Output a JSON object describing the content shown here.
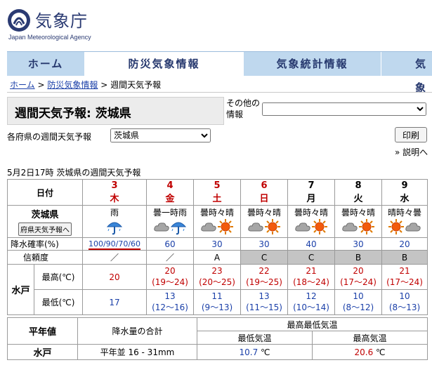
{
  "agency": {
    "name_jp": "気象庁",
    "name_en": "Japan Meteorological Agency"
  },
  "nav": {
    "tabs": [
      "ホーム",
      "防災気象情報",
      "気象統計情報",
      "気象"
    ],
    "active_index": 1
  },
  "breadcrumb": {
    "items": [
      "ホーム",
      "防災気象情報",
      "週間天気予報"
    ],
    "separator": ">"
  },
  "page": {
    "title": "週間天気予報: 茨城県",
    "other_info_label": "その他の情報",
    "other_info_value": "",
    "pref_label": "各府県の週間天気予報",
    "pref_select_value": "茨城県",
    "print_label": "印刷",
    "help_label": "» 説明へ",
    "issued": "5月2日17時  茨城県の週間天気予報"
  },
  "forecast": {
    "header_label": "日付",
    "region": "茨城県",
    "region_button": "府県天気予報へ",
    "precip_label": "降水確率(%)",
    "reliability_label": "信頼度",
    "city": "水戸",
    "max_label": "最高(℃)",
    "min_label": "最低(℃)",
    "days": [
      {
        "date": "3",
        "dow": "木",
        "kind": "hol",
        "weather": "雨",
        "icons": [
          "umbrella"
        ],
        "precip": "100/90/70/60",
        "reliability": "／",
        "rel_grey": false,
        "max": "20",
        "max_range": "",
        "min": "17",
        "min_range": ""
      },
      {
        "date": "4",
        "dow": "金",
        "kind": "hol",
        "weather": "曇一時雨",
        "icons": [
          "cloud",
          "umbrella"
        ],
        "precip": "60",
        "reliability": "／",
        "rel_grey": false,
        "max": "20",
        "max_range": "(19～24)",
        "min": "13",
        "min_range": "(12～16)"
      },
      {
        "date": "5",
        "dow": "土",
        "kind": "hol",
        "weather": "曇時々晴",
        "icons": [
          "cloud",
          "sun"
        ],
        "precip": "30",
        "reliability": "A",
        "rel_grey": false,
        "max": "23",
        "max_range": "(20～25)",
        "min": "11",
        "min_range": "(9～13)"
      },
      {
        "date": "6",
        "dow": "日",
        "kind": "sun",
        "weather": "曇時々晴",
        "icons": [
          "cloud",
          "sun"
        ],
        "precip": "30",
        "reliability": "C",
        "rel_grey": true,
        "max": "22",
        "max_range": "(19～25)",
        "min": "13",
        "min_range": "(11～15)"
      },
      {
        "date": "7",
        "dow": "月",
        "kind": "",
        "weather": "曇時々晴",
        "icons": [
          "cloud",
          "sun"
        ],
        "precip": "40",
        "reliability": "C",
        "rel_grey": true,
        "max": "21",
        "max_range": "(18～24)",
        "min": "12",
        "min_range": "(10～14)"
      },
      {
        "date": "8",
        "dow": "火",
        "kind": "",
        "weather": "曇時々晴",
        "icons": [
          "cloud",
          "sun"
        ],
        "precip": "30",
        "reliability": "B",
        "rel_grey": true,
        "max": "20",
        "max_range": "(17～24)",
        "min": "10",
        "min_range": "(8～12)"
      },
      {
        "date": "9",
        "dow": "水",
        "kind": "",
        "weather": "晴時々曇",
        "icons": [
          "sun",
          "cloud"
        ],
        "precip": "20",
        "reliability": "B",
        "rel_grey": true,
        "max": "21",
        "max_range": "(17～24)",
        "min": "10",
        "min_range": "(8～13)"
      }
    ]
  },
  "normals": {
    "label": "平年値",
    "precip_header": "降水量の合計",
    "temp_header": "最高最低気温",
    "min_header": "最低気温",
    "max_header": "最高気温",
    "city": "水戸",
    "precip_value": "平年並 16 - 31mm",
    "min_value": "10.7",
    "max_value": "20.6",
    "unit": "℃"
  }
}
